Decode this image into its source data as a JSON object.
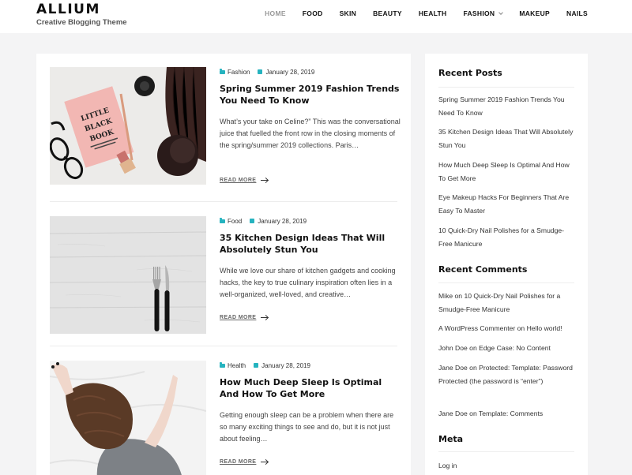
{
  "site": {
    "title": "ALLIUM",
    "tagline": "Creative Blogging Theme"
  },
  "nav": {
    "items": [
      {
        "label": "HOME",
        "active": true
      },
      {
        "label": "FOOD"
      },
      {
        "label": "SKIN"
      },
      {
        "label": "BEAUTY"
      },
      {
        "label": "HEALTH"
      },
      {
        "label": "FASHION",
        "has_dropdown": true
      },
      {
        "label": "MAKEUP"
      },
      {
        "label": "NAILS"
      }
    ]
  },
  "posts": [
    {
      "category": "Fashion",
      "date": "January 28, 2019",
      "title": "Spring Summer 2019 Fashion Trends You Need To Know",
      "excerpt": "What’s your take on Celine?” This was the conversational juice that fuelled the front row in the closing moments of the spring/summer 2019 collections. Paris…",
      "read_more": "READ MORE",
      "image_text": {
        "line1": "LITTLE",
        "line2": "BLACK",
        "line3": "BOOK"
      }
    },
    {
      "category": "Food",
      "date": "January 28, 2019",
      "title": "35 Kitchen Design Ideas That Will Absolutely Stun You",
      "excerpt": "While we love our share of kitchen gadgets and cooking hacks, the key to true culinary inspiration often lies in a well-organized, well-loved, and creative…",
      "read_more": "READ MORE"
    },
    {
      "category": "Health",
      "date": "January 28, 2019",
      "title": "How Much Deep Sleep Is Optimal And How To Get More",
      "excerpt": "Getting enough sleep can be a problem when there are so many exciting things to see and do, but it is not just about feeling…",
      "read_more": "READ MORE"
    }
  ],
  "sidebar": {
    "recent_posts": {
      "title": "Recent Posts",
      "items": [
        "Spring Summer 2019 Fashion Trends You Need To Know",
        "35 Kitchen Design Ideas That Will Absolutely Stun You",
        "How Much Deep Sleep Is Optimal And How To Get More",
        "Eye Makeup Hacks For Beginners That Are Easy To Master",
        "10 Quick-Dry Nail Polishes for a Smudge-Free Manicure"
      ]
    },
    "recent_comments": {
      "title": "Recent Comments",
      "items": [
        "Mike on 10 Quick-Dry Nail Polishes for a Smudge-Free Manicure",
        "A WordPress Commenter on Hello world!",
        "John Doe on Edge Case: No Content",
        "Jane Doe on Protected: Template: Password Protected (the password is “enter”)",
        "Jane Doe on Template: Comments"
      ]
    },
    "meta": {
      "title": "Meta",
      "items": [
        "Log in"
      ]
    }
  },
  "colors": {
    "accent": "#25b3bf",
    "page_bg": "#f4f4f5",
    "card_bg": "#ffffff"
  }
}
